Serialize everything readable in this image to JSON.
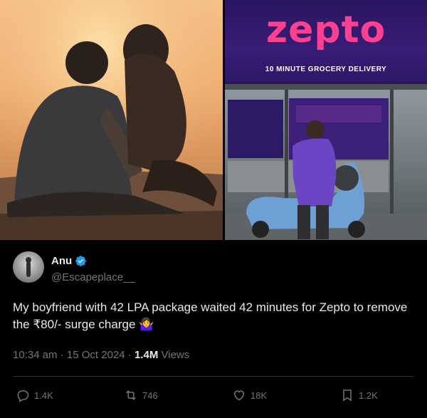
{
  "media": {
    "banner": {
      "brand": "zepto",
      "tagline": "10 MINUTE GROCERY DELIVERY"
    }
  },
  "tweet": {
    "author_name": "Anu",
    "handle": "@Escapeplace__",
    "text": "My boyfriend with 42 LPA package waited 42 minutes for Zepto to remove the ₹80/- surge charge",
    "emoji": "🤷‍♀️",
    "time": "10:34 am",
    "date": "15 Oct 2024",
    "views_count": "1.4M",
    "views_label": "Views"
  },
  "actions": {
    "replies": "1.4K",
    "reposts": "746",
    "likes": "18K",
    "bookmarks": "1.2K"
  },
  "colors": {
    "background": "#000000",
    "text": "#e7e9ea",
    "muted": "#71767b",
    "verified": "#1d9bf0",
    "brand": "#ff3f8f"
  }
}
